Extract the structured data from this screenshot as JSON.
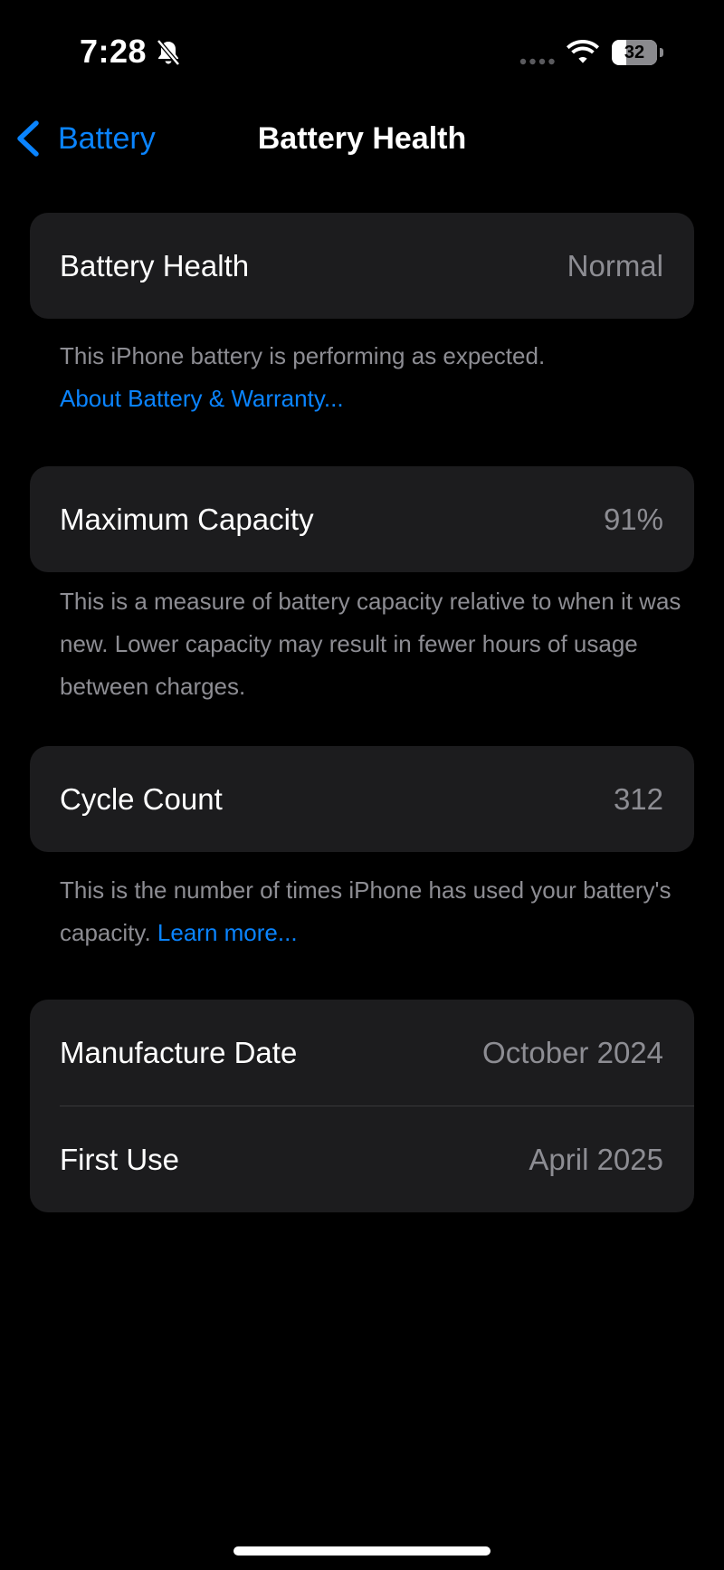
{
  "status_bar": {
    "time": "7:28",
    "battery_level": "32",
    "battery_fraction": 0.32,
    "icons": [
      "bell-slash-icon",
      "cellular-signal-icon",
      "wifi-icon",
      "battery-icon"
    ]
  },
  "nav": {
    "back_label": "Battery",
    "title": "Battery Health"
  },
  "battery_health": {
    "label": "Battery Health",
    "value": "Normal",
    "footer_text": "This iPhone battery is performing as expected.",
    "footer_link": "About Battery & Warranty..."
  },
  "maximum_capacity": {
    "label": "Maximum Capacity",
    "value": "91%",
    "footer_text": "This is a measure of battery capacity relative to when it was new. Lower capacity may result in fewer hours of usage between charges."
  },
  "cycle_count": {
    "label": "Cycle Count",
    "value": "312",
    "footer_text": "This is the number of times iPhone has used your battery's capacity.",
    "footer_link": "Learn more..."
  },
  "dates": {
    "manufacture_label": "Manufacture Date",
    "manufacture_value": "October 2024",
    "first_use_label": "First Use",
    "first_use_value": "April 2025"
  },
  "colors": {
    "background": "#000000",
    "cell": "#1c1c1e",
    "accent": "#0a84ff",
    "secondary_text": "#8d8d93"
  }
}
